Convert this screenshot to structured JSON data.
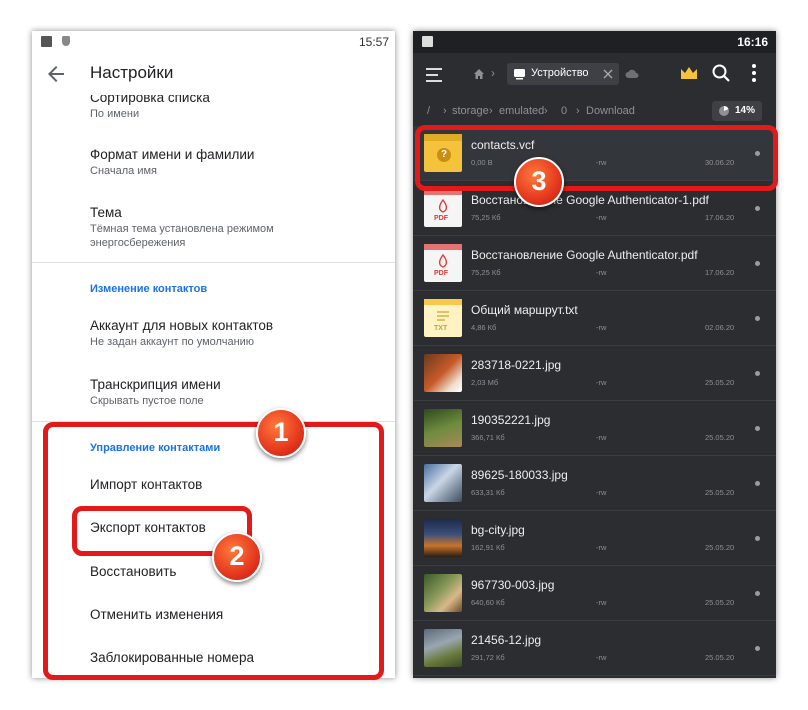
{
  "left_screen": {
    "status_time": "15:57",
    "app_title": "Настройки",
    "items": [
      {
        "title": "Сортировка списка",
        "subtitle": "По имени"
      },
      {
        "title": "Формат имени и фамилии",
        "subtitle": "Сначала имя"
      },
      {
        "title": "Тема",
        "subtitle": "Тёмная тема установлена режимом энергосбережения"
      },
      {
        "title": "Аккаунт для новых контактов",
        "subtitle": "Не задан аккаунт по умолчанию"
      },
      {
        "title": "Транскрипция имени",
        "subtitle": "Скрывать пустое поле"
      },
      {
        "title": "Импорт контактов"
      },
      {
        "title": "Экспорт контактов"
      },
      {
        "title": "Восстановить"
      },
      {
        "title": "Отменить изменения"
      },
      {
        "title": "Заблокированные номера"
      }
    ],
    "section_edit": "Изменение контактов",
    "section_manage": "Управление контактами"
  },
  "right_screen": {
    "status_time": "16:16",
    "tab_label": "Устройство",
    "breadcrumb": [
      "/",
      "storage",
      "emulated",
      "0",
      "Download"
    ],
    "storage_used": "14%",
    "files": [
      {
        "name": "contacts.vcf",
        "size": "0,00 B",
        "perm": "-rw",
        "date": "30.06.20",
        "kind": "unknown"
      },
      {
        "name": "Восстановление Google Authenticator-1.pdf",
        "size": "75,25 Кб",
        "perm": "-rw",
        "date": "17.06.20",
        "kind": "pdf"
      },
      {
        "name": "Восстановление Google Authenticator.pdf",
        "size": "75,25 Кб",
        "perm": "-rw",
        "date": "17.06.20",
        "kind": "pdf"
      },
      {
        "name": "Общий маршрут.txt",
        "size": "4,86 Кб",
        "perm": "-rw",
        "date": "02.06.20",
        "kind": "txt"
      },
      {
        "name": "283718-0221.jpg",
        "size": "2,03 Мб",
        "perm": "-rw",
        "date": "25.05.20",
        "kind": "image"
      },
      {
        "name": "190352221.jpg",
        "size": "366,71 Кб",
        "perm": "-rw",
        "date": "25.05.20",
        "kind": "image"
      },
      {
        "name": "89625-180033.jpg",
        "size": "633,31 Кб",
        "perm": "-rw",
        "date": "25.05.20",
        "kind": "image"
      },
      {
        "name": "bg-city.jpg",
        "size": "162,91 Кб",
        "perm": "-rw",
        "date": "25.05.20",
        "kind": "image"
      },
      {
        "name": "967730-003.jpg",
        "size": "640,60 Кб",
        "perm": "-rw",
        "date": "25.05.20",
        "kind": "image"
      },
      {
        "name": "21456-12.jpg",
        "size": "291,72 Кб",
        "perm": "-rw",
        "date": "25.05.20",
        "kind": "image"
      }
    ],
    "pdf_label": "PDF",
    "txt_label": "TXT"
  },
  "callouts": [
    "1",
    "2",
    "3"
  ],
  "colors": {
    "accent_blue": "#1a73e8",
    "highlight_red": "#e21a1a",
    "dark_bg": "#2b2d31",
    "folder_yellow": "#f5c33b"
  }
}
